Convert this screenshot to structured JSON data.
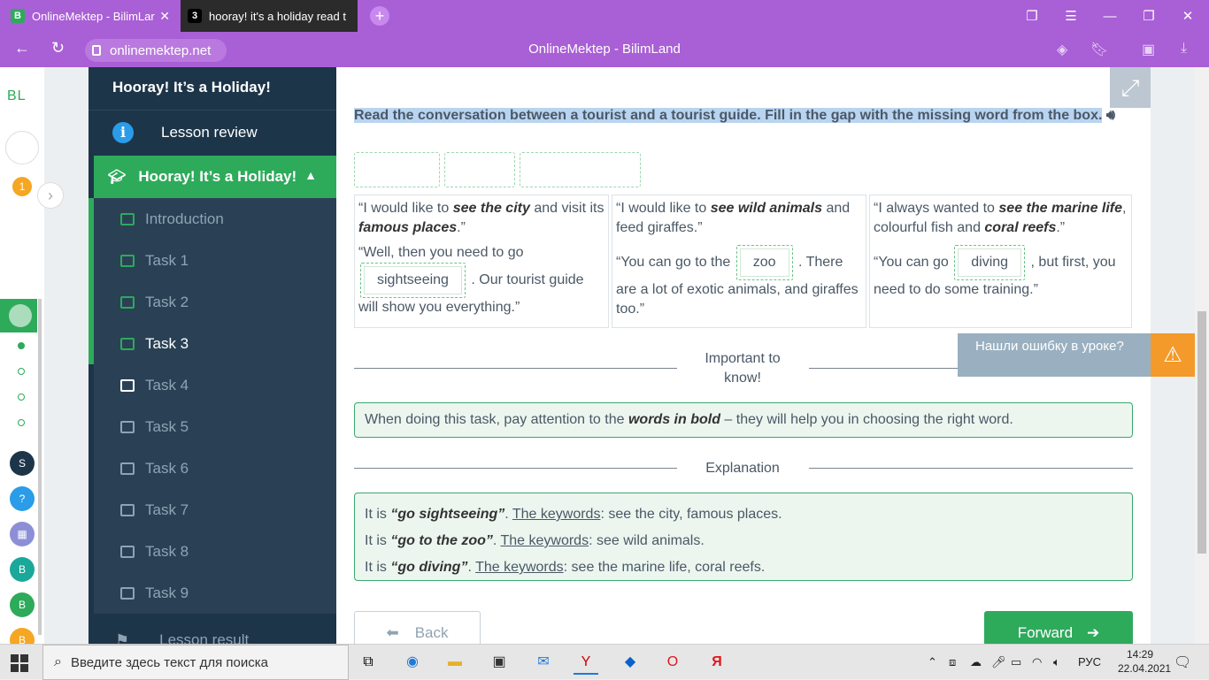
{
  "browser": {
    "tabs": [
      {
        "title": "OnlineMektep - BilimLar",
        "favicon": "B",
        "active": true
      },
      {
        "title": "hooray! it's a holiday read t",
        "favicon": "3",
        "active": false
      }
    ],
    "url": "onlinemektep.net",
    "page_title": "OnlineMektep - BilimLand"
  },
  "rail": {
    "logo": "BL",
    "badge": "1"
  },
  "sidebar": {
    "title": "Hooray! It’s a Holiday!",
    "review": "Lesson review",
    "section": "Hooray! It’s a Holiday!",
    "items": [
      {
        "label": "Introduction",
        "state": "done"
      },
      {
        "label": "Task 1",
        "state": "done"
      },
      {
        "label": "Task 2",
        "state": "done"
      },
      {
        "label": "Task 3",
        "state": "current"
      },
      {
        "label": "Task 4",
        "state": "open"
      },
      {
        "label": "Task 5",
        "state": "locked"
      },
      {
        "label": "Task 6",
        "state": "locked"
      },
      {
        "label": "Task 7",
        "state": "locked"
      },
      {
        "label": "Task 8",
        "state": "locked"
      },
      {
        "label": "Task 9",
        "state": "locked"
      }
    ],
    "result": "Lesson result"
  },
  "task": {
    "instruction": "Read the conversation between a tourist and a tourist guide. Fill in the gap with the missing word from the box.",
    "cards": [
      {
        "p1": [
          "“I would like to ",
          "see the city",
          " and visit its ",
          "famous places",
          ".”"
        ],
        "p2_pre": "“Well, then you need to go",
        "answer": "sightseeing",
        "p2_post": ". Our tourist guide will show you everything.”"
      },
      {
        "p1": [
          "“I would like to ",
          "see wild animals",
          " and feed giraffes.”"
        ],
        "p2_pre": "“You can go to the",
        "answer": "zoo",
        "p2_post": ". There are a lot of exotic animals, and giraffes too.”"
      },
      {
        "p1": [
          "“I always wanted to ",
          "see the marine life",
          ", colourful fish and ",
          "coral reefs",
          ".”"
        ],
        "p2_pre": "“You can go",
        "answer": "diving",
        "p2_post": ", but first, you need to do some training.”"
      }
    ]
  },
  "important": {
    "heading": "Important to know!",
    "pre": "When doing this task, pay attention to the ",
    "bold": "words in bold",
    "post": " – they will help you in choosing the right word."
  },
  "explanation": {
    "heading": "Explanation",
    "lines": [
      {
        "pre": "It is ",
        "phrase": "“go sightseeing”",
        "mid": ". ",
        "link": "The keywords",
        "post": ": see the city, famous places."
      },
      {
        "pre": "It is ",
        "phrase": "“go to the zoo”",
        "mid": ". ",
        "link": "The keywords",
        "post": ": see wild animals."
      },
      {
        "pre": "It is ",
        "phrase": "“go diving”",
        "mid": ". ",
        "link": "The keywords",
        "post": ": see the marine life, coral reefs."
      }
    ]
  },
  "nav": {
    "back": "Back",
    "forward": "Forward"
  },
  "report": "Нашли ошибку в уроке?",
  "taskbar": {
    "search_placeholder": "Введите здесь текст для поиска",
    "lang": "РУС",
    "time": "14:29",
    "date": "22.04.2021"
  },
  "colors": {
    "browser": "#a95fd5",
    "sidebar": "#1d3549",
    "accent": "#2eaa5b",
    "warning": "#f39a2a"
  }
}
